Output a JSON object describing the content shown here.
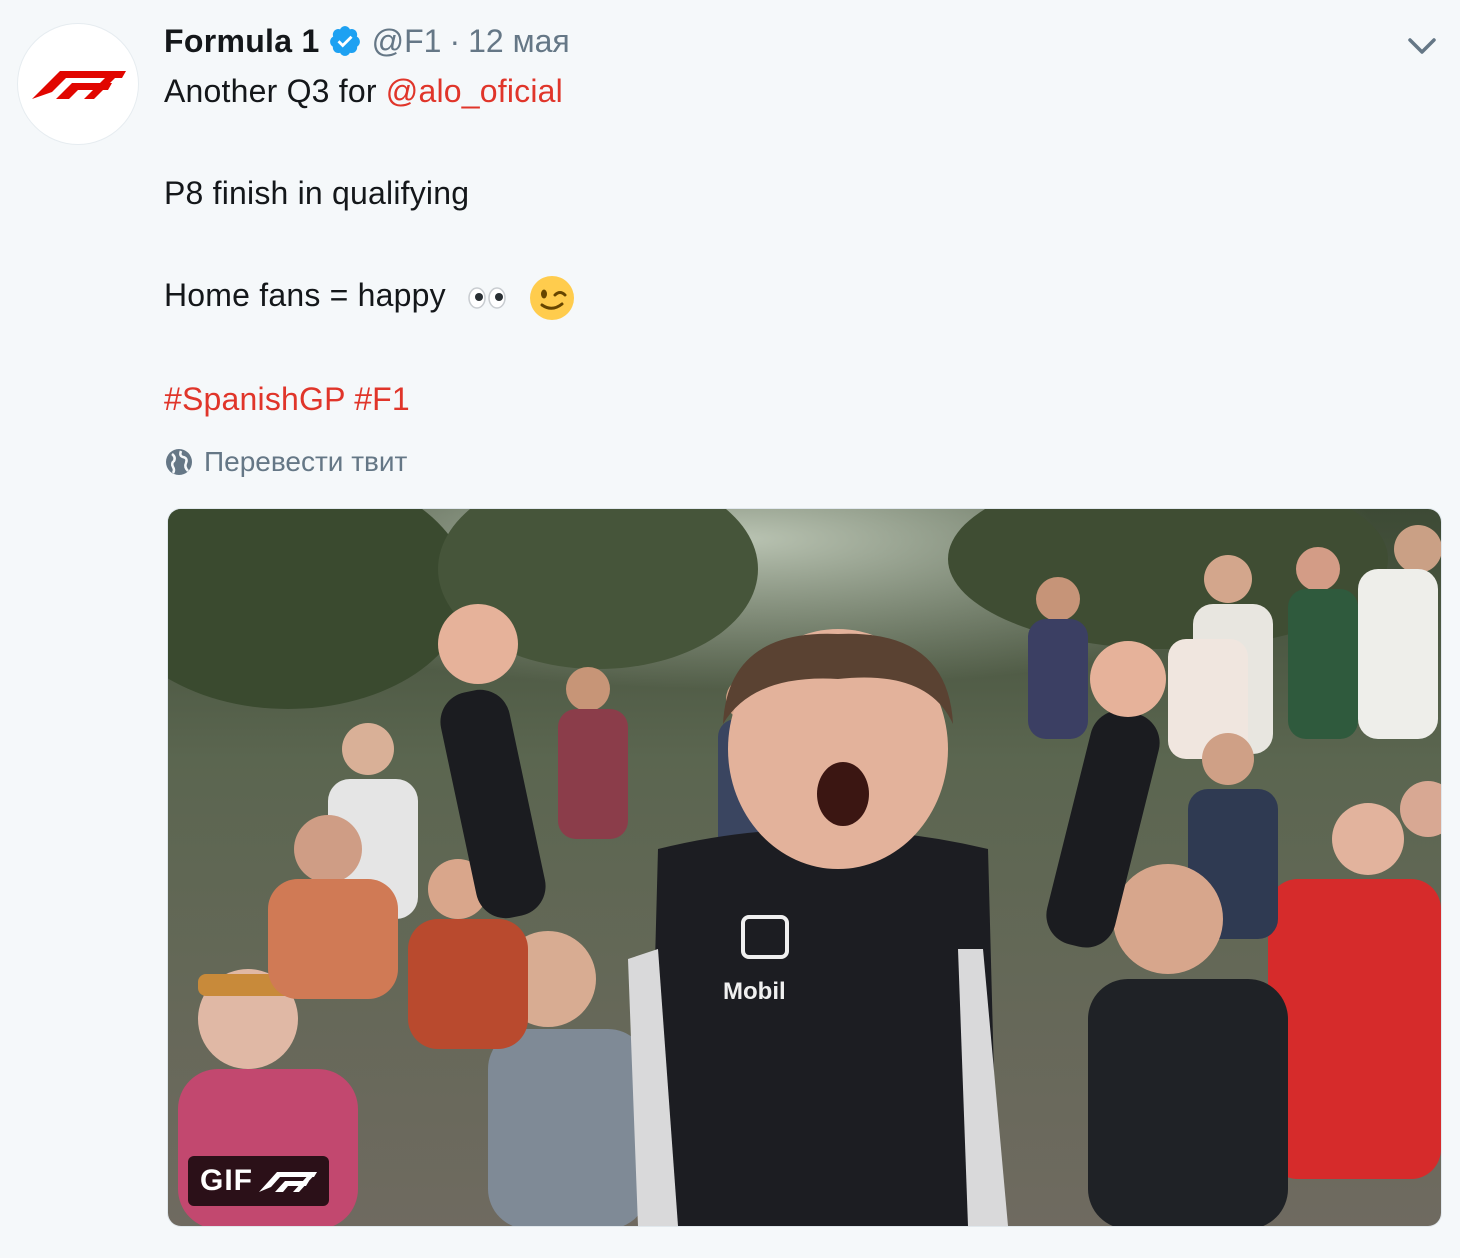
{
  "author": {
    "name": "Formula 1",
    "handle": "@F1",
    "separator": "·",
    "date": "12 мая",
    "avatar_icon": "f1-logo-icon",
    "verified_icon": "verified-badge-icon"
  },
  "tweet": {
    "line1_prefix": "Another Q3 for ",
    "line1_mention": "@alo_oficial",
    "line2": "P8 finish in qualifying",
    "line3_text": "Home fans = happy",
    "line3_emojis": [
      "eyes-emoji-icon",
      "winking-face-emoji-icon"
    ],
    "hashtag1": "#SpanishGP",
    "hashtag2": "#F1"
  },
  "translate": {
    "label": "Перевести твит",
    "icon": "globe-icon"
  },
  "menu": {
    "icon": "chevron-down-icon"
  },
  "media": {
    "type": "gif",
    "badge_label": "GIF",
    "watermark_icon": "f1-logo-icon"
  },
  "colors": {
    "accent": "#e0352a",
    "background": "#f5f8fa",
    "secondary_text": "#657786",
    "verified": "#1da1f2",
    "f1_red": "#e10600"
  }
}
